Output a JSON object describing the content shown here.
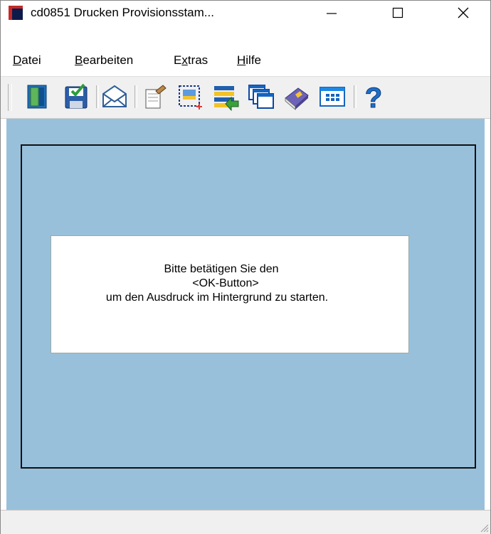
{
  "window": {
    "title": "cd0851 Drucken Provisionsstam..."
  },
  "title_controls": {
    "minimize": "—",
    "maximize": "☐",
    "close": "✕"
  },
  "menu": {
    "items": [
      {
        "first": "D",
        "rest": "atei"
      },
      {
        "first": "B",
        "rest": "earbeiten"
      },
      {
        "pre": "E",
        "first": "x",
        "rest": "tras"
      },
      {
        "first": "H",
        "rest": "ilfe"
      }
    ]
  },
  "toolbar": {
    "icons": [
      "exit-door-icon",
      "save-icon",
      "email-icon",
      "edit-icon",
      "select-area-icon",
      "list-transfer-icon",
      "windows-icon",
      "book-icon",
      "grid-window-icon",
      "help-icon"
    ],
    "help_glyph": "?"
  },
  "message": {
    "line1": "Bitte betätigen Sie den",
    "line2": "<OK-Button>",
    "line3": "um den Ausdruck im Hintergrund zu starten."
  },
  "colors": {
    "client": "#98c0db",
    "accent_red": "#d32f2f",
    "accent_blue": "#1565c0"
  }
}
